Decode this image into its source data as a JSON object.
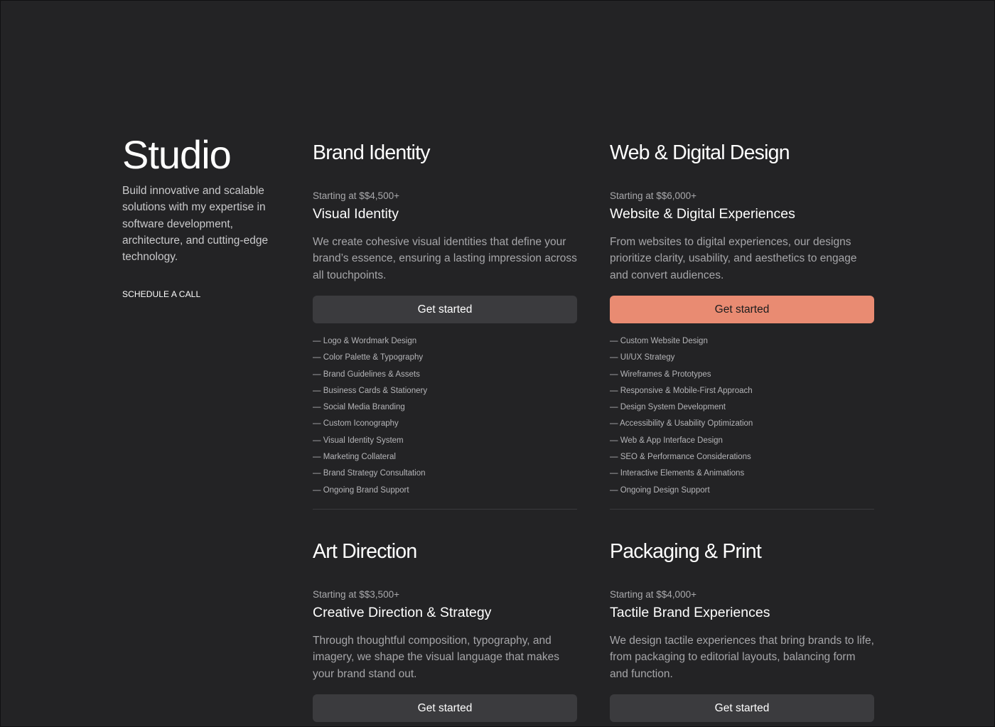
{
  "intro": {
    "title": "Studio",
    "text": "Build innovative and scalable solutions with my expertise in software development, architecture, and cutting-edge technology.",
    "cta": "SCHEDULE A CALL"
  },
  "colors": {
    "background": "#232325",
    "accent_button": "#e98b72",
    "button": "#3b3b3e"
  },
  "services": [
    {
      "title": "Brand Identity",
      "price": "Starting at $$4,500+",
      "subtitle": "Visual Identity",
      "description": "We create cohesive visual identities that define your brand’s essence, ensuring a lasting impression across all touchpoints.",
      "button": "Get started",
      "features": [
        "— Logo & Wordmark Design",
        "— Color Palette & Typography",
        "— Brand Guidelines & Assets",
        "— Business Cards & Stationery",
        "— Social Media Branding",
        "— Custom Iconography",
        "— Visual Identity System",
        "— Marketing Collateral",
        "— Brand Strategy Consultation",
        "— Ongoing Brand Support"
      ]
    },
    {
      "title": "Web & Digital Design",
      "price": "Starting at $$6,000+",
      "subtitle": "Website & Digital Experiences",
      "description": "From websites to digital experiences, our designs prioritize clarity, usability, and aesthetics to engage and convert audiences.",
      "button": "Get started",
      "features": [
        "— Custom Website Design",
        "— UI/UX Strategy",
        "— Wireframes & Prototypes",
        "— Responsive & Mobile-First Approach",
        "— Design System Development",
        "— Accessibility & Usability Optimization",
        "— Web & App Interface Design",
        "— SEO & Performance Considerations",
        "— Interactive Elements & Animations",
        "— Ongoing Design Support"
      ]
    },
    {
      "title": "Art Direction",
      "price": "Starting at $$3,500+",
      "subtitle": "Creative Direction & Strategy",
      "description": "Through thoughtful composition, typography, and imagery, we shape the visual language that makes your brand stand out.",
      "button": "Get started"
    },
    {
      "title": "Packaging & Print",
      "price": "Starting at $$4,000+",
      "subtitle": "Tactile Brand Experiences",
      "description": "We design tactile experiences that bring brands to life, from packaging to editorial layouts, balancing form and function.",
      "button": "Get started"
    }
  ]
}
